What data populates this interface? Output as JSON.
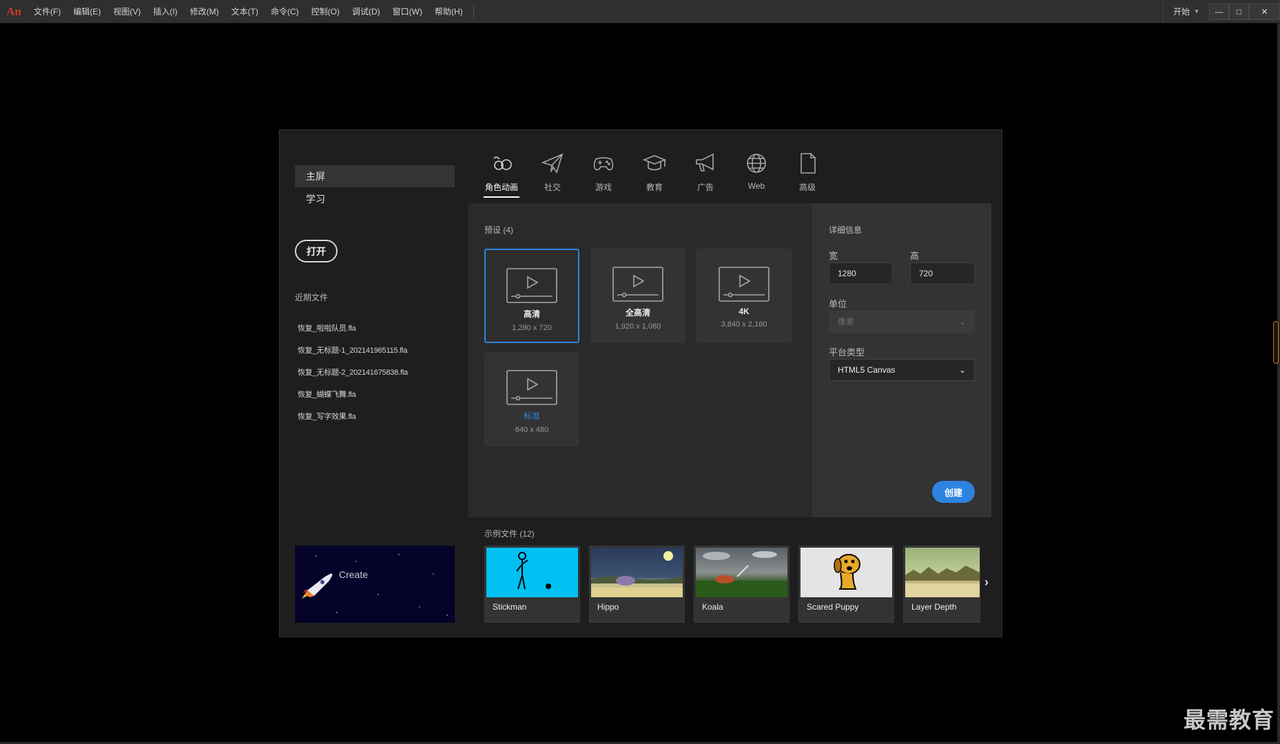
{
  "app": {
    "logo": "An"
  },
  "menu": [
    "文件(F)",
    "编辑(E)",
    "视图(V)",
    "插入(I)",
    "修改(M)",
    "文本(T)",
    "命令(C)",
    "控制(O)",
    "调试(D)",
    "窗口(W)",
    "帮助(H)"
  ],
  "workspace": {
    "label": "开始"
  },
  "window_controls": {
    "minimize": "—",
    "maximize": "□",
    "close": "✕"
  },
  "sidebar": {
    "nav": [
      {
        "label": "主屏",
        "active": true
      },
      {
        "label": "学习",
        "active": false
      }
    ],
    "open_button": "打开",
    "recent_title": "近期文件",
    "recent_files": [
      "恢复_啦啦队员.fla",
      "恢复_无标题-1_202141965115.fla",
      "恢复_无标题-2_202141675838.fla",
      "恢复_蝴蝶飞舞.fla",
      "恢复_写字效果.fla"
    ],
    "banner_label": "Create"
  },
  "tabs": [
    {
      "label": "角色动画",
      "icon": "character-animation-icon",
      "active": true
    },
    {
      "label": "社交",
      "icon": "paper-plane-icon",
      "active": false
    },
    {
      "label": "游戏",
      "icon": "gamepad-icon",
      "active": false
    },
    {
      "label": "教育",
      "icon": "graduation-cap-icon",
      "active": false
    },
    {
      "label": "广告",
      "icon": "megaphone-icon",
      "active": false
    },
    {
      "label": "Web",
      "icon": "globe-icon",
      "active": false
    },
    {
      "label": "高级",
      "icon": "document-icon",
      "active": false
    }
  ],
  "presets": {
    "title": "预设 (4)",
    "items": [
      {
        "name": "高清",
        "size": "1,280 x 720",
        "selected": true
      },
      {
        "name": "全高清",
        "size": "1,920 x 1,080",
        "selected": false
      },
      {
        "name": "4K",
        "size": "3,840 x 2,160",
        "selected": false
      },
      {
        "name": "标准",
        "size": "640 x 480",
        "selected": false
      }
    ]
  },
  "details": {
    "title": "详细信息",
    "width_label": "宽",
    "width_value": "1280",
    "height_label": "高",
    "height_value": "720",
    "unit_label": "单位",
    "unit_value": "像素",
    "platform_label": "平台类型",
    "platform_value": "HTML5 Canvas",
    "create_button": "创建"
  },
  "samples": {
    "title": "示例文件 (12)",
    "items": [
      "Stickman",
      "Hippo",
      "Koala",
      "Scared Puppy",
      "Layer Depth"
    ]
  },
  "watermark": "最需教育",
  "colors": {
    "accent": "#2d84e0",
    "background": "#000000",
    "dialog": "#1e1e1e",
    "panel": "#2a2a2a"
  }
}
